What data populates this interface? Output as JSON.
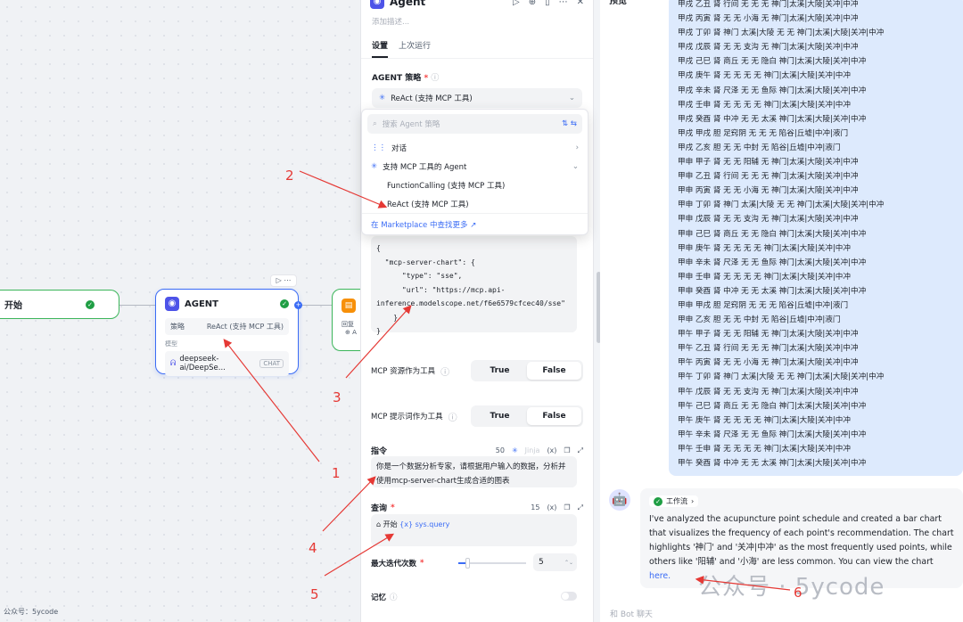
{
  "canvas": {
    "start_label": "开始",
    "agent_node": {
      "title": "AGENT",
      "strategy_key": "策略",
      "strategy_value": "ReAct (支持 MCP 工具)",
      "model_label": "模型",
      "model_value": "deepseek-ai/DeepSe...",
      "model_tag": "CHAT"
    },
    "next_node": {
      "label1": "回复",
      "label2": "⊕ A"
    },
    "footer": "公众号：5ycode"
  },
  "panel": {
    "title": "Agent",
    "desc_placeholder": "添加描述...",
    "tabs": [
      "设置",
      "上次运行"
    ],
    "strategy_label": "AGENT 策略",
    "strategy_selected": "ReAct (支持 MCP 工具)",
    "dropdown": {
      "search_placeholder": "搜索 Agent 策略",
      "group1": "对话",
      "group2": "支持 MCP 工具的 Agent",
      "opt1": "FunctionCalling (支持 MCP 工具)",
      "opt2": "ReAct (支持 MCP 工具)",
      "marketplace": "在 Marketplace 中查找更多 ↗"
    },
    "mcp_config_lines": [
      "{",
      "  \"mcp-server-chart\": {",
      "      \"type\": \"sse\",",
      "      \"url\": \"https://mcp.api-",
      "inference.modelscope.net/f6e6579cfcec40/sse\"",
      "    }",
      "}"
    ],
    "mcp_resource_label": "MCP 资源作为工具",
    "mcp_prompt_label": "MCP 提示词作为工具",
    "true_label": "True",
    "false_label": "False",
    "instruction_label": "指令",
    "instruction_count": "50",
    "jinja": "Jinja",
    "var_icon": "(x)",
    "instruction_text": "你是一个数据分析专家，请根据用户输入的数据，分析并使用mcp-server-chart生成合适的图表",
    "query_label": "查询",
    "query_count": "15",
    "query_chip_prefix": "⌂ 开始",
    "query_chip_var": "{x} sys.query",
    "max_iter_label": "最大迭代次数",
    "max_iter_value": "5",
    "max_iter_fraction": 0.15,
    "memory_label": "记忆"
  },
  "chat": {
    "title": "预览",
    "user_lines": [
      "甲戌 乙丑 肾 行间 无 无 无 神门|太溪|大陵|关冲|中冲",
      "甲戌 丙寅 肾 无 无 小海 无 神门|太溪|大陵|关冲|中冲",
      "甲戌 丁卯 肾 神门 太溪|大陵 无 无 神门|太溪|大陵|关冲|中冲",
      "甲戌 戊辰 肾 无 无 支沟 无 神门|太溪|大陵|关冲|中冲",
      "甲戌 己巳 肾 商丘 无 无 隐白 神门|太溪|大陵|关冲|中冲",
      "甲戌 庚午 肾 无 无 无 无 神门|太溪|大陵|关冲|中冲",
      "甲戌 辛未 肾 尺泽 无 无 鱼际 神门|太溪|大陵|关冲|中冲",
      "甲戌 壬申 肾 无 无 无 无 神门|太溪|大陵|关冲|中冲",
      "甲戌 癸酉 肾 中冲 无 无 太溪 神门|太溪|大陵|关冲|中冲",
      "甲戌 甲戌 胆 足窍阴 无 无 无 陷谷|丘墟|中冲|液门",
      "甲戌 乙亥 胆 无 无 中封 无 陷谷|丘墟|中冲|液门",
      "甲申 甲子 肾 无 无 阳辅 无 神门|太溪|大陵|关冲|中冲",
      "甲申 乙丑 肾 行间 无 无 无 神门|太溪|大陵|关冲|中冲",
      "甲申 丙寅 肾 无 无 小海 无 神门|太溪|大陵|关冲|中冲",
      "甲申 丁卯 肾 神门 太溪|大陵 无 无 神门|太溪|大陵|关冲|中冲",
      "甲申 戊辰 肾 无 无 支沟 无 神门|太溪|大陵|关冲|中冲",
      "甲申 己巳 肾 商丘 无 无 隐白 神门|太溪|大陵|关冲|中冲",
      "甲申 庚午 肾 无 无 无 无 神门|太溪|大陵|关冲|中冲",
      "甲申 辛未 肾 尺泽 无 无 鱼际 神门|太溪|大陵|关冲|中冲",
      "甲申 壬申 肾 无 无 无 无 神门|太溪|大陵|关冲|中冲",
      "甲申 癸酉 肾 中冲 无 无 太溪 神门|太溪|大陵|关冲|中冲",
      "甲申 甲戌 胆 足窍阴 无 无 无 陷谷|丘墟|中冲|液门",
      "甲申 乙亥 胆 无 无 中封 无 陷谷|丘墟|中冲|液门",
      "甲午 甲子 肾 无 无 阳辅 无 神门|太溪|大陵|关冲|中冲",
      "甲午 乙丑 肾 行间 无 无 无 神门|太溪|大陵|关冲|中冲",
      "甲午 丙寅 肾 无 无 小海 无 神门|太溪|大陵|关冲|中冲",
      "甲午 丁卯 肾 神门 太溪|大陵 无 无 神门|太溪|大陵|关冲|中冲",
      "甲午 戊辰 肾 无 无 支沟 无 神门|太溪|大陵|关冲|中冲",
      "甲午 己巳 肾 商丘 无 无 隐白 神门|太溪|大陵|关冲|中冲",
      "甲午 庚午 肾 无 无 无 无 神门|太溪|大陵|关冲|中冲",
      "甲午 辛未 肾 尺泽 无 无 鱼际 神门|太溪|大陵|关冲|中冲",
      "甲午 壬申 肾 无 无 无 无 神门|太溪|大陵|关冲|中冲",
      "甲午 癸酉 肾 中冲 无 无 太溪 神门|太溪|大陵|关冲|中冲"
    ],
    "workflow_tag": "工作流",
    "bot_text": "I've analyzed the acupuncture point schedule and created a bar chart that visualizes the frequency of each point's recommendation. The chart highlights '神门' and '关冲|中冲' as the most frequently used points, while others like '阳辅' and '小海' are less common. You can view the chart",
    "bot_link": "here.",
    "input_placeholder": "和 Bot 聊天",
    "watermark": "公众号 · 5ycode"
  },
  "annotations": [
    "1",
    "2",
    "3",
    "4",
    "5",
    "6"
  ],
  "colors": {
    "accent": "#3b6cf5",
    "annotation": "#e53935",
    "success": "#1f9e44"
  }
}
